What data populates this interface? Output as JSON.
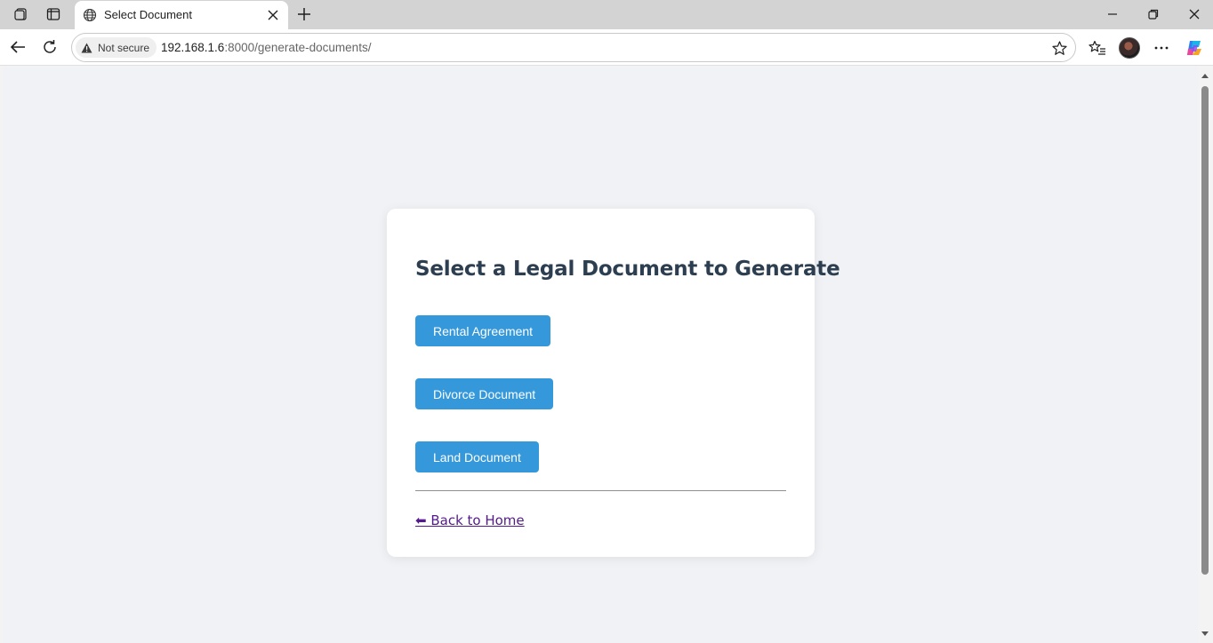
{
  "browser": {
    "tab_title": "Select Document",
    "security_label": "Not secure",
    "url_host": "192.168.1.6",
    "url_rest": ":8000/generate-documents/"
  },
  "page": {
    "heading": "Select a Legal Document to Generate",
    "buttons": [
      {
        "label": "Rental Agreement"
      },
      {
        "label": "Divorce Document"
      },
      {
        "label": "Land Document"
      }
    ],
    "back_link": "⬅ Back to Home"
  },
  "colors": {
    "button_bg": "#3498db",
    "heading": "#2c3e50",
    "page_bg": "#f0f2f5",
    "link_visited": "#551a8b"
  }
}
